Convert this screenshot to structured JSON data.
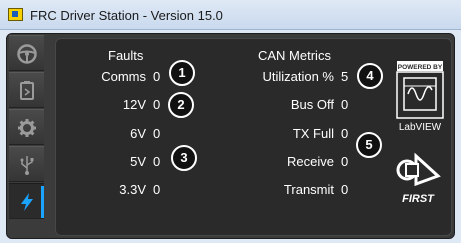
{
  "window": {
    "title": "FRC Driver Station - Version 15.0"
  },
  "sidebar": {
    "tabs": [
      {
        "name": "operation",
        "icon": "steering-wheel-icon",
        "active": false
      },
      {
        "name": "diagnostics",
        "icon": "battery-diagnostics-icon",
        "active": false
      },
      {
        "name": "setup",
        "icon": "gear-icon",
        "active": false
      },
      {
        "name": "usb-devices",
        "icon": "usb-icon",
        "active": false
      },
      {
        "name": "power-can",
        "icon": "lightning-icon",
        "active": true
      }
    ],
    "active_indicator_color": "#1aa3ff"
  },
  "faults": {
    "header": "Faults",
    "rows": [
      {
        "label": "Comms",
        "value": "0"
      },
      {
        "label": "12V",
        "value": "0"
      },
      {
        "label": "6V",
        "value": "0"
      },
      {
        "label": "5V",
        "value": "0"
      },
      {
        "label": "3.3V",
        "value": "0"
      }
    ]
  },
  "can_metrics": {
    "header": "CAN Metrics",
    "rows": [
      {
        "label": "Utilization %",
        "value": "5"
      },
      {
        "label": "Bus Off",
        "value": "0"
      },
      {
        "label": "TX Full",
        "value": "0"
      },
      {
        "label": "Receive",
        "value": "0"
      },
      {
        "label": "Transmit",
        "value": "0"
      }
    ]
  },
  "callouts": [
    "1",
    "2",
    "3",
    "4",
    "5"
  ],
  "logos": {
    "labview": {
      "top": "POWERED BY",
      "bottom": "LabVIEW"
    },
    "first": "FIRST"
  },
  "colors": {
    "panel_bg": "#2a2a2a",
    "frame_bg": "#3b3b3b",
    "text": "#ffffff"
  }
}
